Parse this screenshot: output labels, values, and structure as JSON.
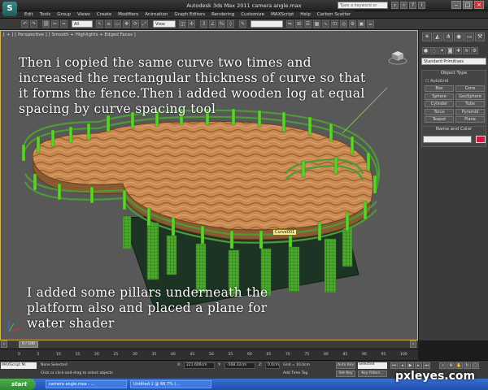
{
  "titlebar": {
    "title": "Autodesk 3ds Max 2011     camera angle.max",
    "search_placeholder": "Type a keyword or phrase",
    "logo": "S"
  },
  "menubar": {
    "items": [
      "Edit",
      "Tools",
      "Group",
      "Views",
      "Create",
      "Modifiers",
      "Animation",
      "Graph Editors",
      "Rendering",
      "Customize",
      "MAXScript",
      "Help",
      "Carbon Scatter"
    ]
  },
  "toolbar": {
    "filter_select": "All",
    "view_select": "View"
  },
  "viewport": {
    "label": "[ + ] [ Perspective ] [ Smooth + Highlights + Edged Faces ]",
    "caption_top": "Then i copied the same curve two times and increased the rectangular thickness of curve so that it forms the fence.Then i added wooden log at equal spacing by curve spacing tool",
    "caption_bottom": "I added some pillars underneath the platform also and placed a plane for water shader",
    "object_tag": "Curve001"
  },
  "command_panel": {
    "dropdown": "Standard Primitives",
    "object_type_title": "Object Type",
    "autogrid_label": "AutoGrid",
    "buttons": [
      "Box",
      "Cone",
      "Sphere",
      "GeoSphere",
      "Cylinder",
      "Tube",
      "Torus",
      "Pyramid",
      "Teapot",
      "Plane"
    ],
    "name_color_title": "Name and Color"
  },
  "timeline": {
    "frame_display": "0 / 100",
    "ticks": [
      "0",
      "5",
      "10",
      "15",
      "20",
      "25",
      "30",
      "35",
      "40",
      "45",
      "50",
      "55",
      "60",
      "65",
      "70",
      "75",
      "80",
      "85",
      "90",
      "95",
      "100"
    ]
  },
  "statusbar": {
    "maxscript_label": "MAXScript Mi",
    "selection": "None Selected",
    "prompt": "Click or click-and-drag to select objects",
    "x_label": "X:",
    "x_value": "221.606cm",
    "y_label": "Y:",
    "y_value": "-568.32cm",
    "z_label": "Z:",
    "z_value": "0.0cm",
    "grid": "Grid = 10.0cm",
    "add_time_tag": "Add Time Tag",
    "auto_key": "Auto Key",
    "selected": "Selected",
    "set_key": "Set Key",
    "key_filters": "Key Filters..."
  },
  "taskbar": {
    "start": "start",
    "tasks": [
      "camera angle.max - ...",
      "Untitled-1 @ 66.7% (..."
    ]
  },
  "watermark": "pxleyes.com",
  "colors": {
    "viewport_bg": "#585858",
    "active_border": "#d8b548",
    "fence": "#2f8f2f",
    "posts": "#5fcf2a",
    "wood": "#c5824a",
    "water_plane": "#1d3324",
    "name_color": "#c81e46"
  }
}
